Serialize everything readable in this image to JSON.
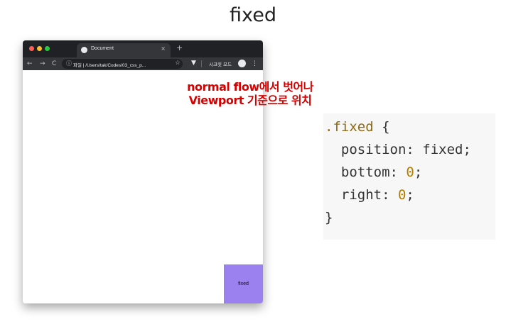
{
  "slide": {
    "title": "fixed"
  },
  "browser": {
    "tab_title": "Document",
    "tab_close": "×",
    "new_tab": "+",
    "nav": {
      "back": "←",
      "forward": "→",
      "reload": "C"
    },
    "omnibox": {
      "info_icon": "ⓘ",
      "text": "파일 | /Users/tak/Codes/03_css_p..."
    },
    "star": "☆",
    "extension": "▼",
    "incognito_label": "시크릿 모드",
    "menu": "⋮"
  },
  "page": {
    "fixed_box_label": "fixed"
  },
  "annotation": {
    "line1": "normal flow에서 벗어나",
    "line2": "Viewport 기준으로 위치"
  },
  "code": {
    "selector": ".fixed",
    "open_brace": " {",
    "prop1": "  position: fixed;",
    "prop2_name": "  bottom: ",
    "prop2_value": "0",
    "prop2_end": ";",
    "prop3_name": "  right: ",
    "prop3_value": "0",
    "prop3_end": ";",
    "close_brace": "}"
  },
  "colors": {
    "annotation": "#d60000",
    "fixed_box": "#9b80f0",
    "selector": "#8a6a15",
    "number": "#b07d00"
  }
}
